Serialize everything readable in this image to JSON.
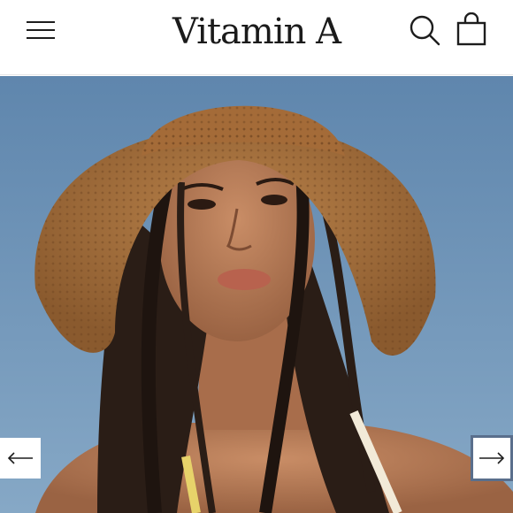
{
  "header": {
    "logo_text": "Vitamin A",
    "menu_icon": "hamburger-menu-icon",
    "search_icon": "search-icon",
    "cart_icon": "shopping-bag-icon"
  },
  "hero": {
    "image_subject": "hero-photo",
    "prev_icon": "arrow-left-icon",
    "next_icon": "arrow-right-icon"
  },
  "colors": {
    "sky": "#6f93b6",
    "hat": "#a8703c",
    "skin": "#b47a58",
    "hair": "#2a1d16",
    "focus_outline": "#5a6f8c"
  }
}
